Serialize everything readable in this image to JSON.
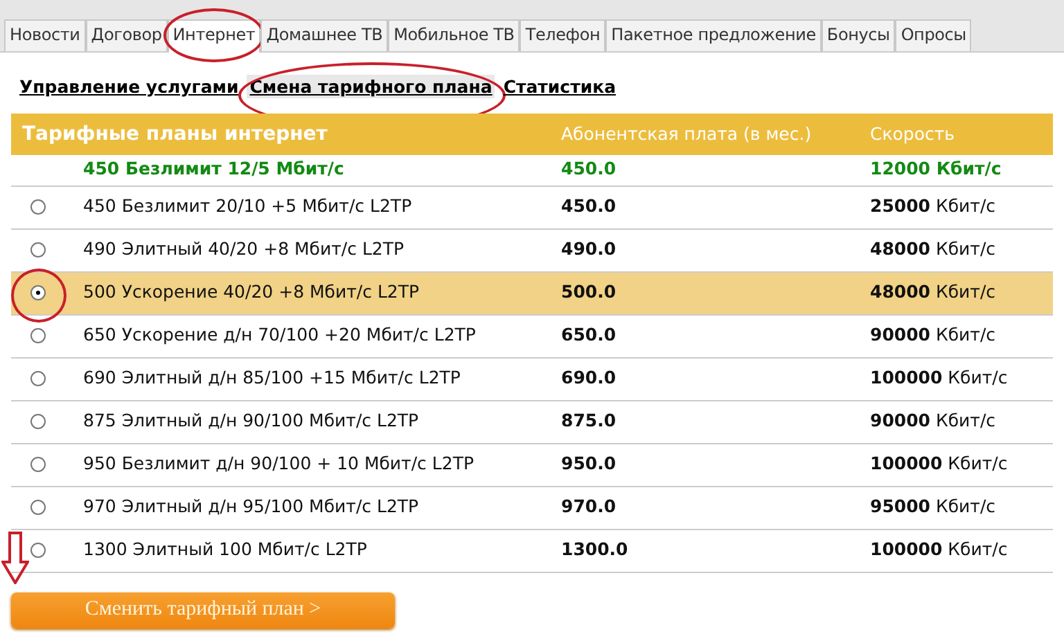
{
  "tabs": [
    {
      "label": "Новости",
      "selected": false
    },
    {
      "label": "Договор",
      "selected": false
    },
    {
      "label": "Интернет",
      "selected": true
    },
    {
      "label": "Домашнее ТВ",
      "selected": false
    },
    {
      "label": "Мобильное ТВ",
      "selected": false
    },
    {
      "label": "Телефон",
      "selected": false
    },
    {
      "label": "Пакетное предложение",
      "selected": false
    },
    {
      "label": "Бонусы",
      "selected": false
    },
    {
      "label": "Опросы",
      "selected": false
    }
  ],
  "subnav": [
    {
      "label": "Управление услугами",
      "selected": false
    },
    {
      "label": "Смена тарифного плана",
      "selected": true
    },
    {
      "label": "Статистика",
      "selected": false
    }
  ],
  "table": {
    "columns": [
      "Тарифные планы интернет",
      "Абонентская плата (в мес.)",
      "Скорость"
    ],
    "current_plan": {
      "name": "450 Безлимит 12/5 Мбит/с",
      "price": "450.0",
      "speed": "12000 Кбит/с"
    },
    "rows": [
      {
        "name": "450 Безлимит 20/10 +5 Мбит/с L2TP",
        "price": "450.0",
        "speed": "**25000** Кбит/с",
        "selected": false
      },
      {
        "name": "490 Элитный 40/20 +8 Мбит/с L2TP",
        "price": "490.0",
        "speed": "**48000** Кбит/с",
        "selected": false
      },
      {
        "name": "500 Ускорение 40/20 +8 Мбит/с L2TP",
        "price": "500.0",
        "speed": "**48000** Кбит/с",
        "selected": true
      },
      {
        "name": "650 Ускорение д/н 70/100 +20 Мбит/с L2TP",
        "price": "650.0",
        "speed": "**90000** Кбит/с",
        "selected": false
      },
      {
        "name": "690 Элитный д/н 85/100 +15 Мбит/с L2TP",
        "price": "690.0",
        "speed": "**100000** Кбит/с",
        "selected": false
      },
      {
        "name": "875 Элитный д/н 90/100 Мбит/с L2TP",
        "price": "875.0",
        "speed": "**90000** Кбит/с",
        "selected": false
      },
      {
        "name": "950 Безлимит д/н 90/100 + 10 Мбит/с L2TP",
        "price": "950.0",
        "speed": "**100000** Кбит/с",
        "selected": false
      },
      {
        "name": "970 Элитный д/н 95/100 Мбит/с L2TP",
        "price": "970.0",
        "speed": "**95000** Кбит/с",
        "selected": false
      },
      {
        "name": "1300 Элитный 100 Мбит/с L2TP",
        "price": "1300.0",
        "speed": "**100000** Кбит/с",
        "selected": false
      }
    ]
  },
  "button": {
    "label": "Сменить тарифный план >"
  }
}
